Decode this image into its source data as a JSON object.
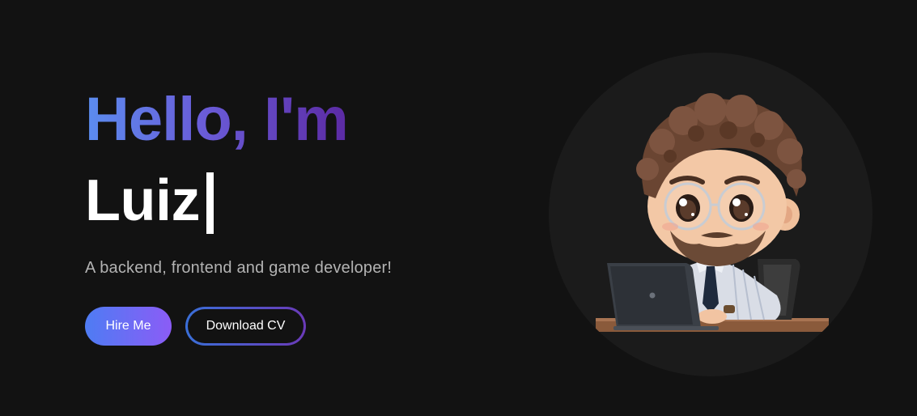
{
  "hero": {
    "greeting": "Hello, I'm",
    "name": "Luiz",
    "tagline": "A backend, frontend and game developer!",
    "hire_label": "Hire Me",
    "cv_label": "Download CV"
  },
  "avatar": {
    "icon": "developer-avatar-illustration"
  },
  "colors": {
    "background": "#121212",
    "gradient_start": "#5b8def",
    "gradient_end": "#5b2aa3",
    "hire_gradient_start": "#4e7cf3",
    "hire_gradient_end": "#8b5cf6"
  }
}
